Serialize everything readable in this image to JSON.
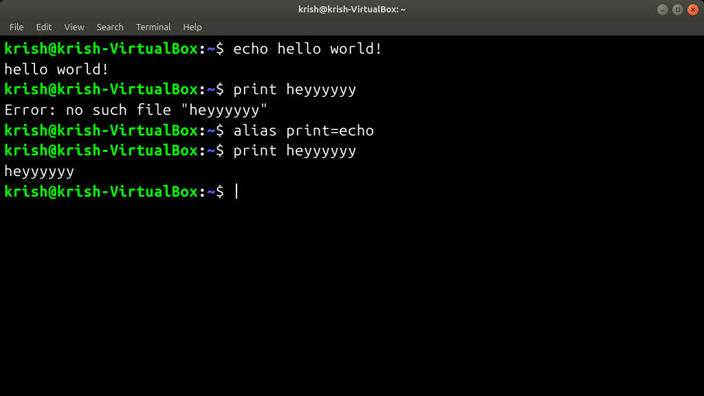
{
  "window": {
    "title": "krish@krish-VirtualBox: ~"
  },
  "menubar": {
    "items": [
      "File",
      "Edit",
      "View",
      "Search",
      "Terminal",
      "Help"
    ]
  },
  "prompt": {
    "user_host": "krish@krish-VirtualBox",
    "colon": ":",
    "path": "~",
    "dollar": "$"
  },
  "lines": [
    {
      "type": "cmd",
      "text": "echo hello world!"
    },
    {
      "type": "out",
      "text": "hello world!"
    },
    {
      "type": "cmd",
      "text": "print heyyyyyy"
    },
    {
      "type": "out",
      "text": "Error: no such file \"heyyyyyy\""
    },
    {
      "type": "cmd",
      "text": "alias print=echo"
    },
    {
      "type": "cmd",
      "text": "print heyyyyyy"
    },
    {
      "type": "out",
      "text": "heyyyyyy"
    },
    {
      "type": "cmd",
      "text": "",
      "cursor": true
    }
  ]
}
